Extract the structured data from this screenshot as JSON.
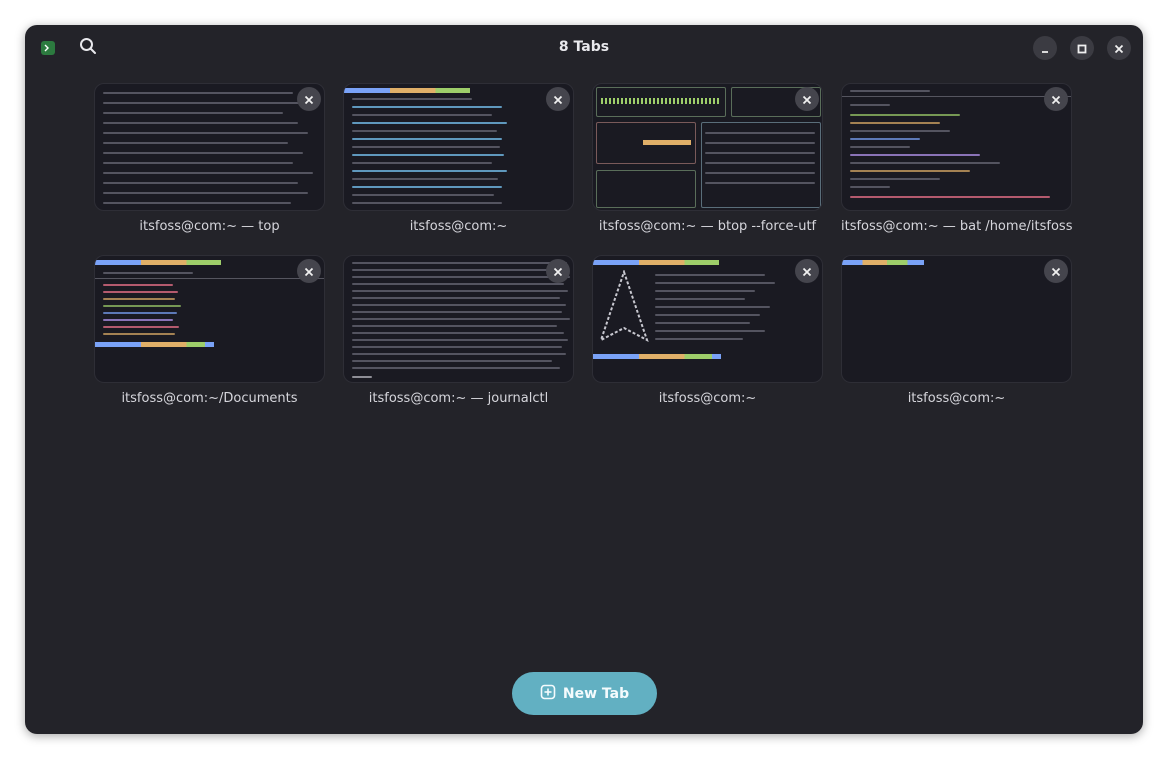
{
  "window": {
    "title": "8 Tabs",
    "icons": {
      "app": "terminal-app-icon",
      "search": "search-icon",
      "minimize": "minimize-icon",
      "maximize": "maximize-icon",
      "close": "close-icon"
    }
  },
  "tabs": [
    {
      "label": "itsfoss@com:~ — top"
    },
    {
      "label": "itsfoss@com:~"
    },
    {
      "label": "itsfoss@com:~ — btop --force-utf"
    },
    {
      "label": "itsfoss@com:~ — bat /home/itsfoss/.bashrc"
    },
    {
      "label": "itsfoss@com:~/Documents"
    },
    {
      "label": "itsfoss@com:~ — journalctl"
    },
    {
      "label": "itsfoss@com:~"
    },
    {
      "label": "itsfoss@com:~"
    }
  ],
  "new_tab": {
    "label": "New Tab",
    "icon": "plus-square-icon"
  },
  "colors": {
    "background": "#232329",
    "accent": "#62b0c2",
    "thumbnail": "#1a1a22",
    "text": "#e8e8ec"
  }
}
